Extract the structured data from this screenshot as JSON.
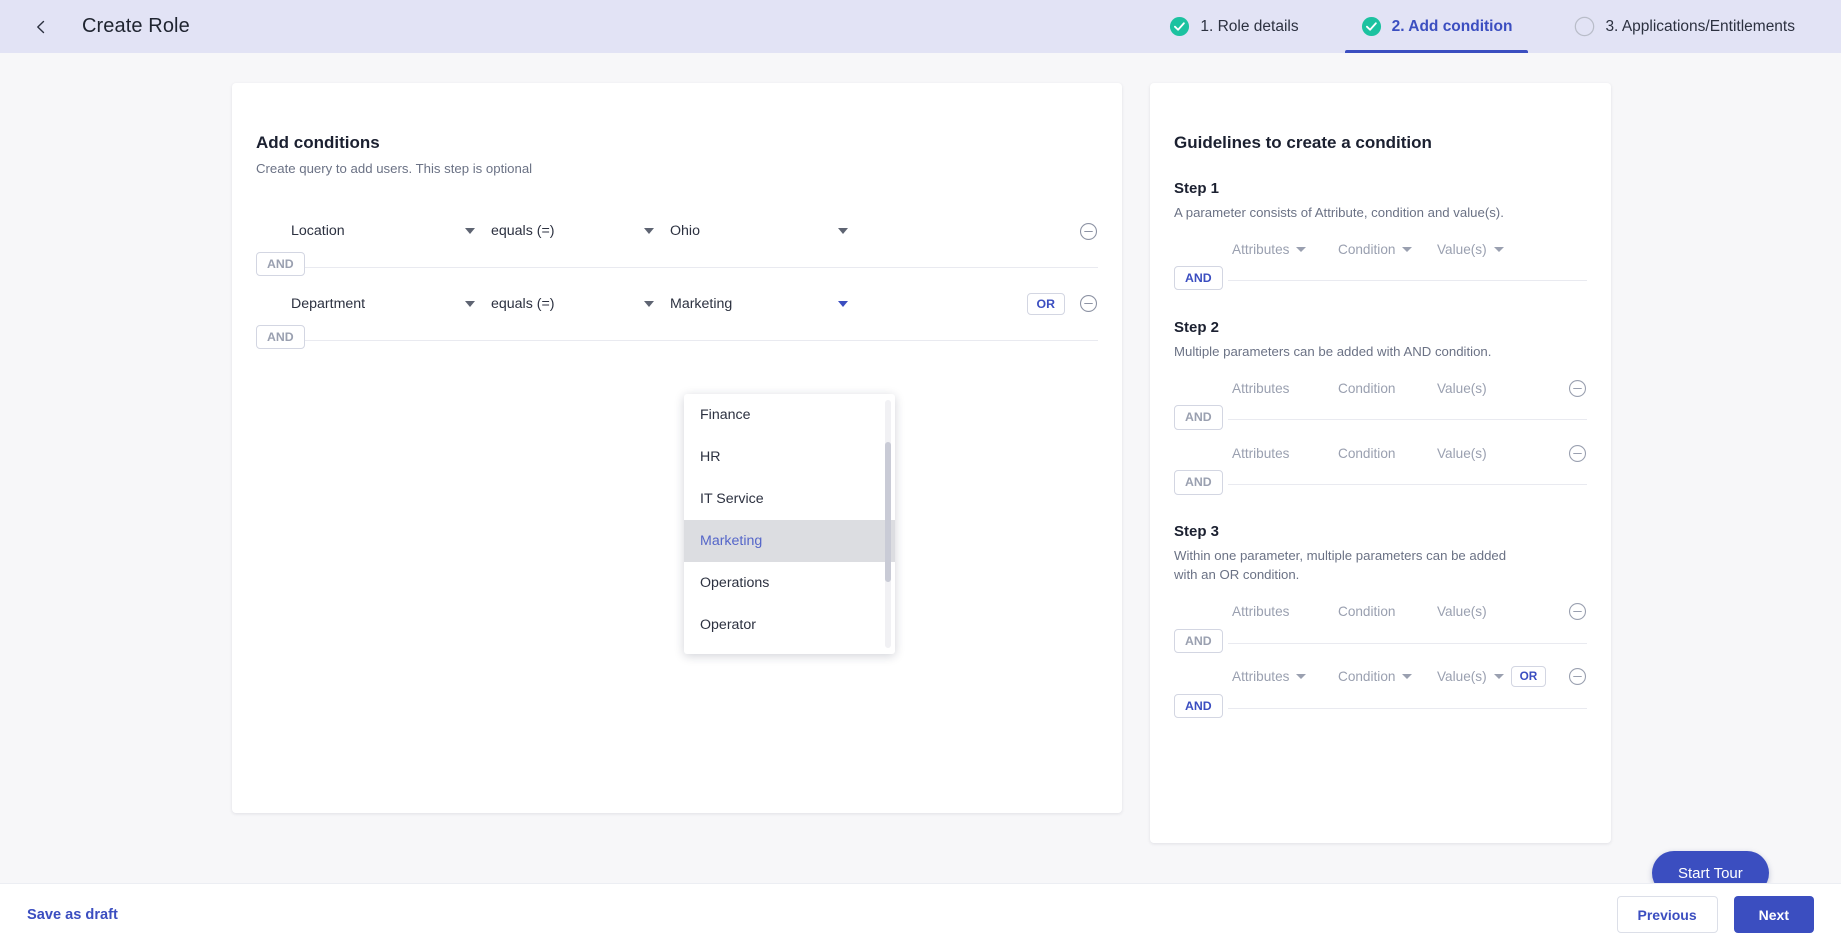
{
  "header": {
    "back_icon": "chevron-left-icon",
    "title": "Create Role",
    "steps": [
      {
        "label": "1. Role details",
        "state": "complete",
        "icon": "check-circle-icon"
      },
      {
        "label": "2. Add condition",
        "state": "active",
        "icon": "check-circle-icon"
      },
      {
        "label": "3. Applications/Entitlements",
        "state": "pending",
        "icon": "empty-circle-icon"
      }
    ]
  },
  "conditions_panel": {
    "title": "Add conditions",
    "subtitle": "Create query to add users. This step is optional",
    "rows": [
      {
        "attribute": "Location",
        "condition": "equals (=)",
        "value": "Ohio",
        "value_caret_active": false,
        "or_label": null,
        "remove_icon": "circle-minus-icon",
        "and_label": "AND",
        "and_active": false
      },
      {
        "attribute": "Department",
        "condition": "equals (=)",
        "value": "Marketing",
        "value_caret_active": true,
        "or_label": "OR",
        "remove_icon": "circle-minus-icon",
        "and_label": "AND",
        "and_active": false
      }
    ]
  },
  "dropdown": {
    "open": true,
    "selected": "Marketing",
    "options": [
      "Finance",
      "HR",
      "IT Service",
      "Marketing",
      "Operations",
      "Operator"
    ]
  },
  "guidelines_panel": {
    "title": "Guidelines to create a condition",
    "steps": [
      {
        "title": "Step 1",
        "description": "A parameter consists of Attribute, condition and value(s).",
        "rows": [
          {
            "attributes": "Attributes",
            "condition": "Condition",
            "values": "Value(s)",
            "carets": true,
            "or_label": null,
            "remove": false,
            "and_label": "AND",
            "and_active": true
          }
        ]
      },
      {
        "title": "Step 2",
        "description": "Multiple parameters can be added with AND condition.",
        "rows": [
          {
            "attributes": "Attributes",
            "condition": "Condition",
            "values": "Value(s)",
            "carets": false,
            "or_label": null,
            "remove": true,
            "and_label": "AND",
            "and_active": false
          },
          {
            "attributes": "Attributes",
            "condition": "Condition",
            "values": "Value(s)",
            "carets": false,
            "or_label": null,
            "remove": true,
            "and_label": "AND",
            "and_active": false
          }
        ]
      },
      {
        "title": "Step 3",
        "description": "Within one parameter, multiple parameters can be added with an OR condition.",
        "rows": [
          {
            "attributes": "Attributes",
            "condition": "Condition",
            "values": "Value(s)",
            "carets": false,
            "or_label": null,
            "remove": true,
            "and_label": "AND",
            "and_active": false
          },
          {
            "attributes": "Attributes",
            "condition": "Condition",
            "values": "Value(s)",
            "carets": true,
            "or_label": "OR",
            "remove": true,
            "and_label": "AND",
            "and_active": true
          }
        ]
      }
    ]
  },
  "start_tour": {
    "label": "Start Tour"
  },
  "footer": {
    "save_draft_label": "Save as draft",
    "previous_label": "Previous",
    "next_label": "Next"
  },
  "colors": {
    "accent": "#3b4ec0",
    "header_bg": "#e2e3f5",
    "complete_green": "#1cc2a0",
    "page_bg": "#f7f7f9"
  }
}
